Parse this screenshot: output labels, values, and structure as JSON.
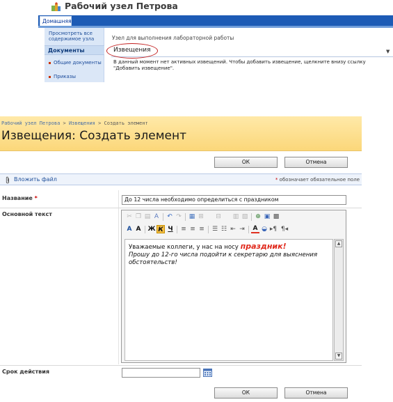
{
  "site": {
    "title": "Рабочий узел Петрова",
    "home_tab": "Домашняя"
  },
  "quicklaunch": {
    "view_all": "Просмотреть все содержимое узла",
    "section": "Документы",
    "items": [
      {
        "label": "Общие документы"
      },
      {
        "label": "Приказы"
      }
    ]
  },
  "webpart": {
    "description": "Узел для выполнения лабораторной работы",
    "title": "Извещения",
    "empty_message": "В данный момент нет активных извещений. Чтобы добавить извещение, щелкните внизу ссылку \"Добавить извещение\"."
  },
  "form": {
    "breadcrumb": {
      "site": "Рабочий узел Петрова",
      "list": "Извещения",
      "current": "Создать элемент",
      "separator": " > "
    },
    "page_title": "Извещения: Создать элемент",
    "ok_label": "ОК",
    "cancel_label": "Отмена",
    "attach_label": "Вложить файл",
    "required_star": "*",
    "required_note": "обозначает обязательное поле",
    "fields": {
      "title_label": "Название",
      "title_value": "До 12 числа необходимо определиться с праздником",
      "body_label": "Основной текст",
      "expires_label": "Срок действия",
      "expires_value": ""
    },
    "body": {
      "line1_start": "Уважаемые коллеги, у нас на носу ",
      "highlight": "праздник!",
      "line2": "Прошу до 12-го числа подойти к секретарю для выяснения обстоятельств!"
    }
  },
  "colors": {
    "topnav": "#1d5bb5",
    "title_band": "#fbd77a",
    "required": "#cc0000",
    "highlight_text": "#e0281b",
    "annotation_circle": "#c21e1e"
  }
}
